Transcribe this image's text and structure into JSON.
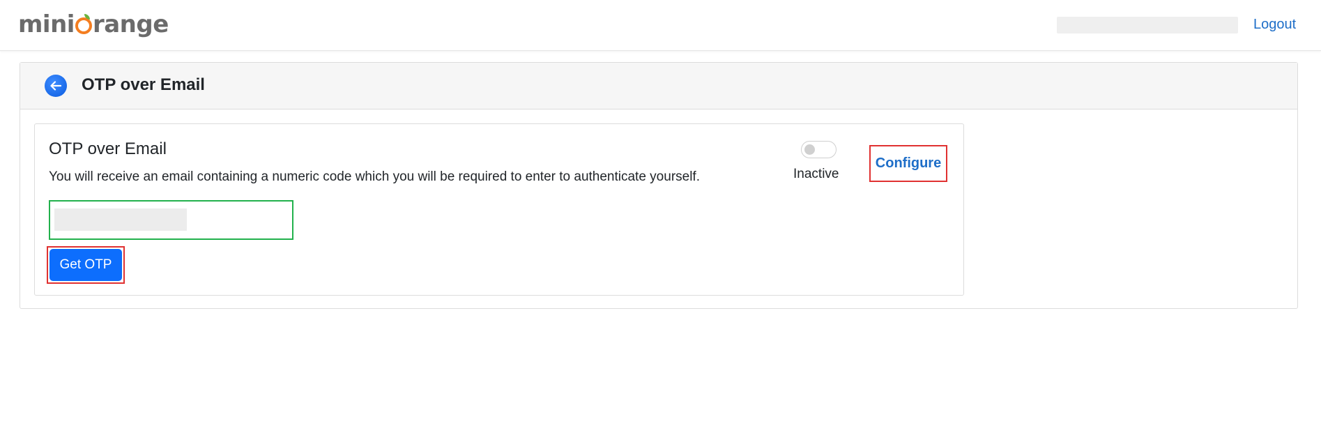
{
  "header": {
    "logo_text_left": "mini",
    "logo_text_right": "range",
    "logout_label": "Logout"
  },
  "page": {
    "title": "OTP over Email"
  },
  "method": {
    "title": "OTP over Email",
    "description": "You will receive an email containing a numeric code which you will be required to enter to authenticate yourself.",
    "status_label": "Inactive",
    "toggle_on": false,
    "configure_label": "Configure",
    "email_value": "",
    "get_otp_label": "Get OTP"
  },
  "colors": {
    "primary_button": "#0d6efd",
    "link": "#1e6ec8",
    "highlight_red": "#e03131",
    "input_border_green": "#22b14c",
    "logo_orange": "#f47e20",
    "logo_green": "#6cb33e"
  },
  "icons": {
    "back": "arrow-left-icon",
    "logo_o": "orange-o-logo-icon"
  }
}
